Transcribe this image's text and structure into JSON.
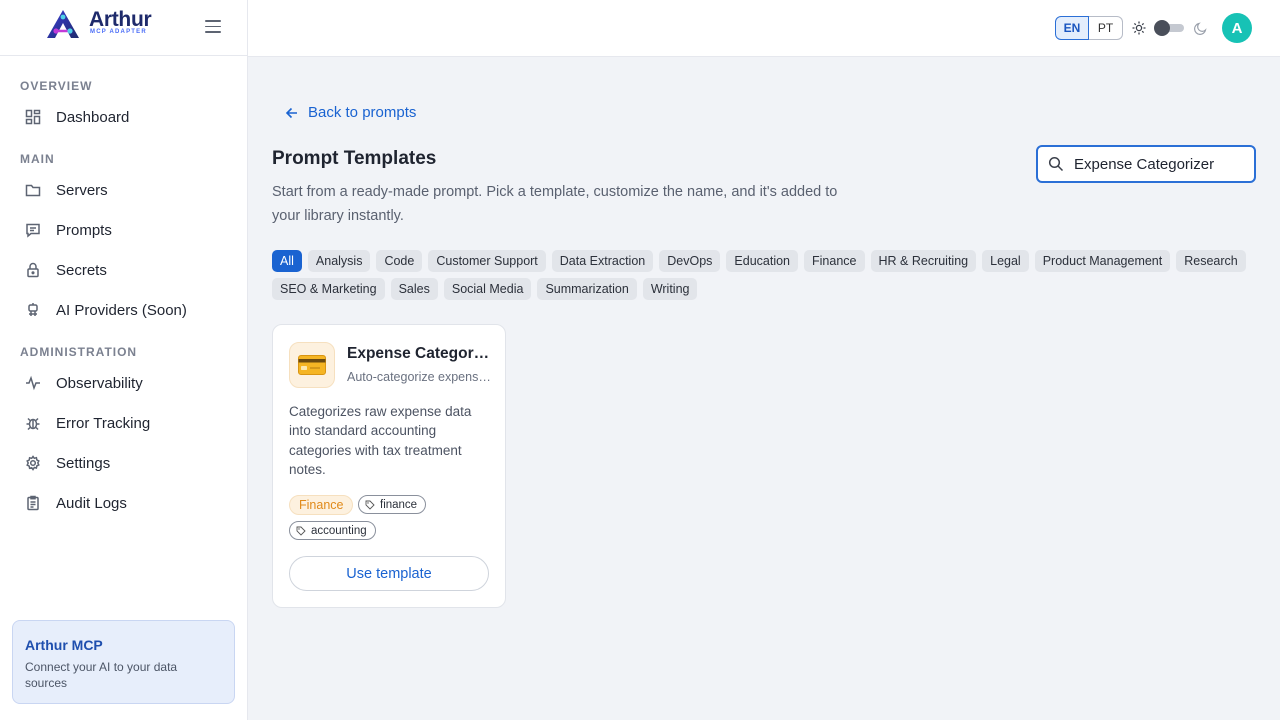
{
  "brand": {
    "name": "Arthur",
    "subtitle": "MCP ADAPTER"
  },
  "sidebar": {
    "sections": [
      {
        "label": "OVERVIEW"
      },
      {
        "label": "MAIN"
      },
      {
        "label": "ADMINISTRATION"
      }
    ],
    "items": [
      {
        "label": "Dashboard",
        "icon": "dashboard-icon"
      },
      {
        "label": "Servers",
        "icon": "folder-icon"
      },
      {
        "label": "Prompts",
        "icon": "message-icon"
      },
      {
        "label": "Secrets",
        "icon": "lock-icon"
      },
      {
        "label": "AI Providers (Soon)",
        "icon": "robot-icon"
      },
      {
        "label": "Observability",
        "icon": "activity-icon"
      },
      {
        "label": "Error Tracking",
        "icon": "bug-icon"
      },
      {
        "label": "Settings",
        "icon": "gear-icon"
      },
      {
        "label": "Audit Logs",
        "icon": "clipboard-icon"
      }
    ],
    "promo": {
      "title": "Arthur MCP",
      "text": "Connect your AI to your data sources"
    }
  },
  "topbar": {
    "languages": [
      "EN",
      "PT"
    ],
    "active_language": "EN",
    "avatar_initial": "A"
  },
  "main": {
    "back_link": "Back to prompts",
    "title": "Prompt Templates",
    "subtitle": "Start from a ready-made prompt. Pick a template, customize the name, and it's added to your library instantly.",
    "search": {
      "value": "Expense Categorizer",
      "placeholder": ""
    },
    "categories": [
      "All",
      "Analysis",
      "Code",
      "Customer Support",
      "Data Extraction",
      "DevOps",
      "Education",
      "Finance",
      "HR & Recruiting",
      "Legal",
      "Product Management",
      "Research",
      "SEO & Marketing",
      "Sales",
      "Social Media",
      "Summarization",
      "Writing"
    ],
    "active_category": "All",
    "templates": [
      {
        "icon": "💳",
        "title": "Expense Categorizer",
        "subtitle": "Auto-categorize expenses",
        "description": "Categorizes raw expense data into standard accounting categories with tax treatment notes.",
        "category": "Finance",
        "tags": [
          "finance",
          "accounting"
        ],
        "action": "Use template"
      }
    ]
  },
  "colors": {
    "accent": "#1a63d1",
    "teal_avatar": "#17c2b5",
    "finance_tag": "#e08a1a"
  }
}
